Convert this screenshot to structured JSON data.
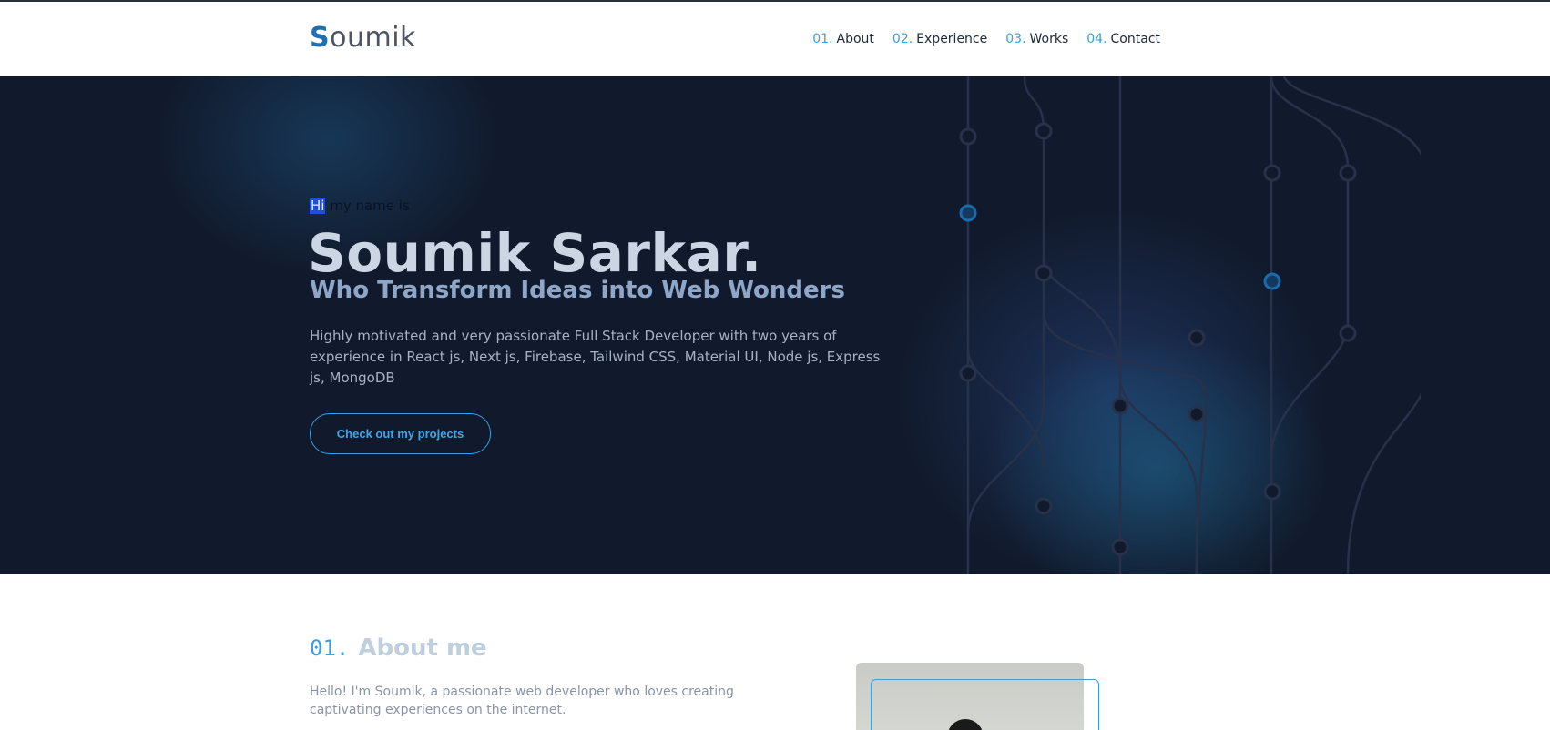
{
  "brand": {
    "first_letter": "S",
    "rest": "oumik"
  },
  "nav": {
    "items": [
      {
        "num": "01.",
        "label": "About"
      },
      {
        "num": "02.",
        "label": "Experience"
      },
      {
        "num": "03.",
        "label": "Works"
      },
      {
        "num": "04.",
        "label": "Contact"
      }
    ]
  },
  "hero": {
    "greeting_hi": "Hi",
    "greeting_rest": " my name is",
    "name": "Soumik Sarkar.",
    "tagline": "Who Transform Ideas into Web Wonders",
    "description": "Highly motivated and very passionate Full Stack Developer with two years of experience in  React js, Next js, Firebase, Tailwind CSS, Material UI, Node js, Express js, MongoDB",
    "cta_label": "Check out my projects"
  },
  "about": {
    "num": "01.",
    "title": "About me",
    "text": "Hello! I'm Soumik, a passionate web developer who loves creating captivating experiences on the internet."
  },
  "colors": {
    "accent": "#38a0e0",
    "hero_bg": "#111a2c",
    "brand_blue": "#1f6fb2"
  }
}
